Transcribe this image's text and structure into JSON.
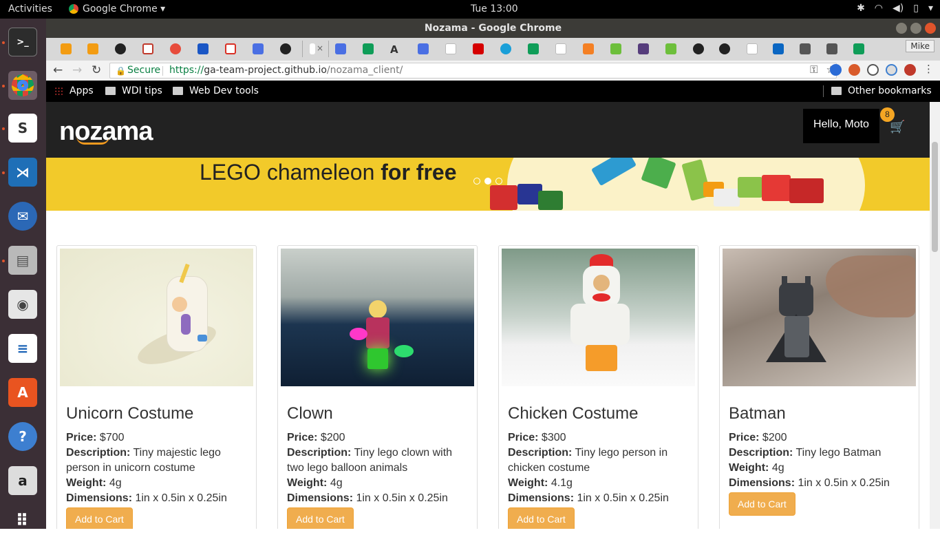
{
  "system": {
    "activities": "Activities",
    "app_menu": "Google Chrome ▾",
    "clock": "Tue 13:00"
  },
  "window": {
    "title": "Nozama - Google Chrome",
    "profile": "Mike"
  },
  "address_bar": {
    "secure_label": "Secure",
    "url_scheme": "https://",
    "url_host": "ga-team-project.github.io",
    "url_path": "/nozama_client/"
  },
  "bookmarks": {
    "apps": "Apps",
    "items": [
      "WDI tips",
      "Web Dev tools"
    ],
    "other": "Other bookmarks"
  },
  "site": {
    "logo": "nozama",
    "greeting": "Hello, Moto",
    "cart_count": "8"
  },
  "carousel": {
    "text_plain": "LEGO chameleon ",
    "text_bold": "for free",
    "slide_count": 3,
    "active_slide": 2
  },
  "products": [
    {
      "name": "Unicorn Costume",
      "price_label": "Price:",
      "price": "$700",
      "desc_label": "Description:",
      "description": "Tiny majestic lego person in unicorn costume",
      "weight_label": "Weight:",
      "weight": "4g",
      "dim_label": "Dimensions:",
      "dimensions": "1in x 0.5in x 0.25in",
      "button": "Add to Cart"
    },
    {
      "name": "Clown",
      "price_label": "Price:",
      "price": "$200",
      "desc_label": "Description:",
      "description": "Tiny lego clown with two lego balloon animals",
      "weight_label": "Weight:",
      "weight": "4g",
      "dim_label": "Dimensions:",
      "dimensions": "1in x 0.5in x 0.25in",
      "button": "Add to Cart"
    },
    {
      "name": "Chicken Costume",
      "price_label": "Price:",
      "price": "$300",
      "desc_label": "Description:",
      "description": "Tiny lego person in chicken costume",
      "weight_label": "Weight:",
      "weight": "4.1g",
      "dim_label": "Dimensions:",
      "dimensions": "1in x 0.5in x 0.25in",
      "button": "Add to Cart"
    },
    {
      "name": "Batman",
      "price_label": "Price:",
      "price": "$200",
      "desc_label": "Description:",
      "description": "Tiny lego Batman",
      "weight_label": "Weight:",
      "weight": "4g",
      "dim_label": "Dimensions:",
      "dimensions": "1in x 0.5in x 0.25in",
      "button": "Add to Cart"
    }
  ],
  "colors": {
    "accent": "#f0ad4e",
    "navbar": "#222222",
    "banner": "#f2ca2a",
    "secure_green": "#0b8043"
  }
}
